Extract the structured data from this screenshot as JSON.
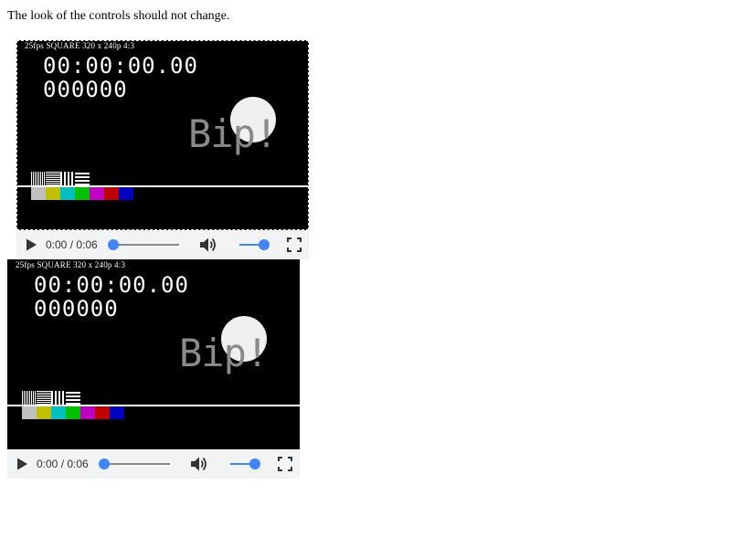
{
  "instruction": "The look of the controls should not change.",
  "video_frame": {
    "caption": "25fps SQUARE 320 x 240p 4:3",
    "timecode": "00:00:00.00",
    "frame_count": "000000",
    "bip_text": "Bip!",
    "color_bars": [
      "#c0c0c0",
      "#c0c000",
      "#00c0c0",
      "#00c000",
      "#c000c0",
      "#c00000",
      "#0000c0"
    ]
  },
  "players": [
    {
      "time_display": "0:00 / 0:06",
      "seek_fraction": 0.0,
      "volume_fraction": 1.0,
      "play_icon": "play-icon",
      "mute_icon": "volume-icon",
      "fullscreen_icon": "fullscreen-icon"
    },
    {
      "time_display": "0:00 / 0:06",
      "seek_fraction": 0.0,
      "volume_fraction": 1.0,
      "play_icon": "play-icon",
      "mute_icon": "volume-icon",
      "fullscreen_icon": "fullscreen-icon"
    }
  ],
  "colors": {
    "control_bar": "#f1f3f4",
    "accent": "#4285f4",
    "icon": "#333333"
  }
}
